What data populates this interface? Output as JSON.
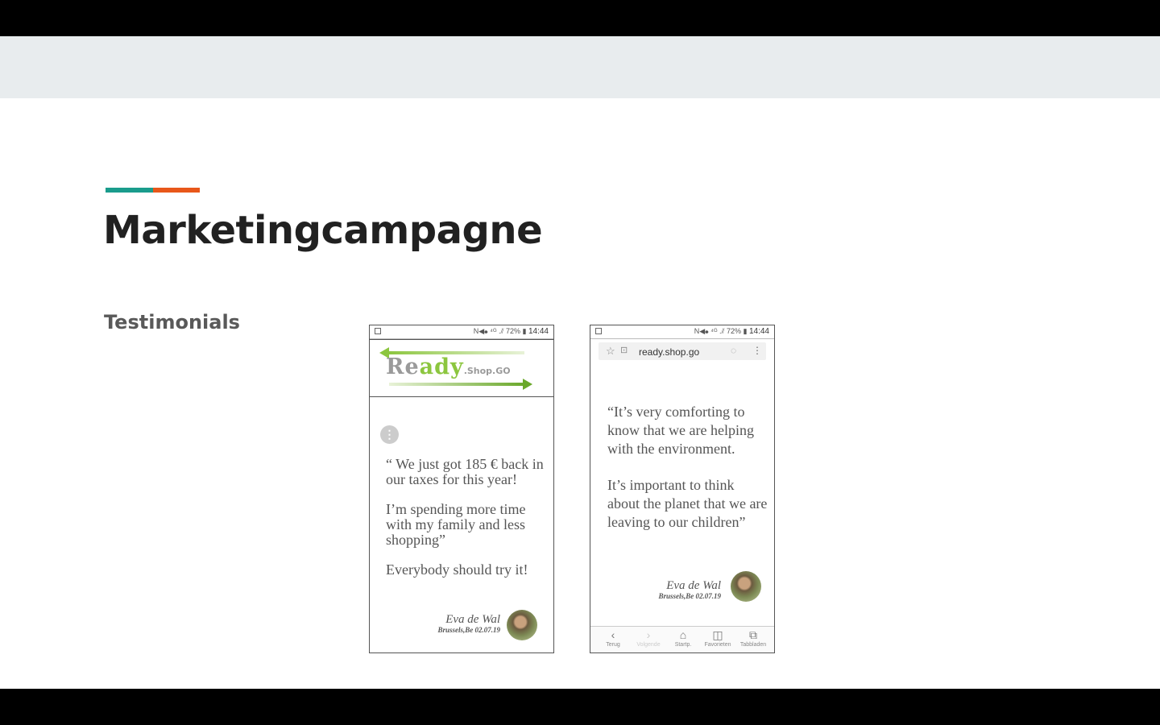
{
  "slide": {
    "title": "Marketingcampagne",
    "subtitle": "Testimonials",
    "accent_colors": [
      "#1a9c8c",
      "#e8571a"
    ]
  },
  "phone1": {
    "status": {
      "icons": "N◀⦁ ⁴ᴳ .⫽ 72% ▮",
      "time": "14:44"
    },
    "logo": {
      "main_a": "Re",
      "main_b": "ady",
      "small": ".Shop.GO"
    },
    "quote": [
      "“ We just got 185 € back in our taxes  for this year!",
      "I’m spending more time with my family and less shopping”",
      "Everybody should try it!"
    ],
    "signature": {
      "name": "Eva de Wal",
      "place": "Brussels,Be 02.07.19"
    }
  },
  "phone2": {
    "status": {
      "icons": "N◀⦁ ⁴ᴳ .⫽ 72% ▮",
      "time": "14:44"
    },
    "browser": {
      "url": "ready.shop.go"
    },
    "quote": [
      "“It’s very comforting to know that we are helping with the environment.",
      "It’s important to think about the planet that we are leaving to our children”"
    ],
    "signature": {
      "name": "Eva de Wal",
      "place": "Brussels,Be 02.07.19"
    },
    "nav": [
      {
        "icon": "‹",
        "label": "Terug"
      },
      {
        "icon": "›",
        "label": "Volgende"
      },
      {
        "icon": "⌂",
        "label": "Startp."
      },
      {
        "icon": "◫",
        "label": "Favorieten"
      },
      {
        "icon": "⧉",
        "label": "Tabbladen"
      }
    ]
  }
}
